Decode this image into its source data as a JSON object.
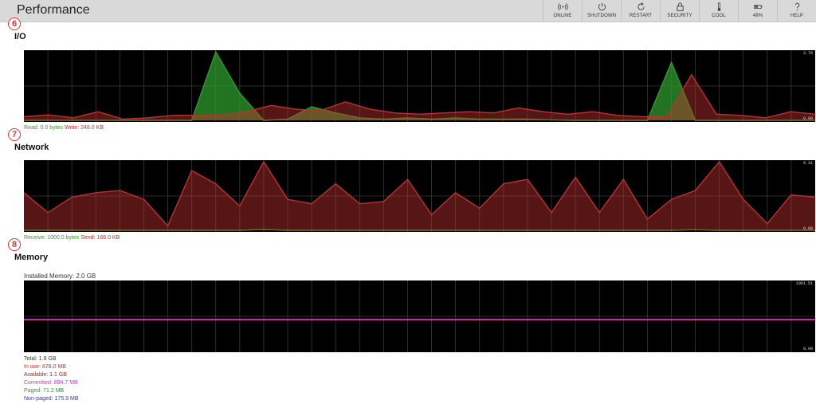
{
  "header": {
    "title": "Performance",
    "toolbar": [
      {
        "id": "online",
        "label": "ONLINE",
        "icon": "wifi-icon"
      },
      {
        "id": "shutdown",
        "label": "SHUTDOWN",
        "icon": "power-icon"
      },
      {
        "id": "restart",
        "label": "RESTART",
        "icon": "restart-icon"
      },
      {
        "id": "security",
        "label": "SECURITY",
        "icon": "lock-icon"
      },
      {
        "id": "cool",
        "label": "COOL",
        "icon": "thermometer-icon"
      },
      {
        "id": "battery",
        "label": "49%",
        "icon": "battery-icon"
      },
      {
        "id": "help",
        "label": "HELP",
        "icon": "help-icon"
      }
    ]
  },
  "io": {
    "badge": "6",
    "title": "I/O",
    "max_label": "2.78",
    "min_label": "0.00",
    "read_text": "Read: 0.0 bytes",
    "write_text": "Write: 248.0 KB",
    "read_color": "#2e9b2e",
    "write_color": "#c03030"
  },
  "network": {
    "badge": "7",
    "title": "Network",
    "max_label": "0.31",
    "min_label": "0.00",
    "receive_text": "Receive: 1000.0 bytes",
    "send_text": "Send: 166.0 KB",
    "receive_color": "#2e9b2e",
    "send_color": "#c03030"
  },
  "memory": {
    "badge": "8",
    "title": "Memory",
    "installed": "Installed Memory: 2.0 GB",
    "max_label": "1961.51",
    "min_label": "0.00",
    "stats": [
      {
        "text": "Total: 1.9 GB",
        "color": "#333333"
      },
      {
        "text": "In use: 878.0 MB",
        "color": "#c03030"
      },
      {
        "text": "Available: 1.1 GB",
        "color": "#8b2b2b"
      },
      {
        "text": "Committed: 894.7 MB",
        "color": "#c23bc2"
      },
      {
        "text": "Paged: 71.2 MB",
        "color": "#2e9b2e"
      },
      {
        "text": "Non-paged: 175.9 MB",
        "color": "#3a3aa8"
      }
    ]
  },
  "chart_data": [
    {
      "type": "area",
      "ylim": [
        0,
        2.78
      ],
      "grid": true,
      "series": [
        {
          "name": "Read",
          "color": "#2e9b2e",
          "values": [
            0,
            0,
            0,
            0,
            0,
            0,
            0,
            0,
            2.78,
            1.1,
            0,
            0.05,
            0.55,
            0.3,
            0.1,
            0.05,
            0.1,
            0.05,
            0.1,
            0.05,
            0.05,
            0.05,
            0.02,
            0,
            0,
            0,
            0,
            2.35,
            0,
            0,
            0,
            0,
            0,
            0
          ]
        },
        {
          "name": "Write",
          "color": "#c03030",
          "values": [
            0.15,
            0.22,
            0.1,
            0.35,
            0.05,
            0.1,
            0.2,
            0.2,
            0.2,
            0.35,
            0.6,
            0.45,
            0.4,
            0.75,
            0.45,
            0.3,
            0.25,
            0.3,
            0.35,
            0.3,
            0.5,
            0.35,
            0.25,
            0.35,
            0.2,
            0.15,
            0.15,
            1.85,
            0.25,
            0.2,
            0.1,
            0.35,
            0.25
          ]
        }
      ]
    },
    {
      "type": "area",
      "ylim": [
        0,
        0.31
      ],
      "grid": true,
      "series": [
        {
          "name": "Receive",
          "color": "#2e9b2e",
          "values": [
            0,
            0,
            0,
            0,
            0,
            0,
            0,
            0,
            0,
            0,
            0.004,
            0,
            0,
            0,
            0,
            0,
            0,
            0,
            0,
            0,
            0,
            0,
            0,
            0,
            0,
            0,
            0,
            0,
            0.003,
            0,
            0,
            0,
            0,
            0
          ]
        },
        {
          "name": "Send",
          "color": "#c03030",
          "values": [
            0.17,
            0.08,
            0.15,
            0.17,
            0.18,
            0.14,
            0.02,
            0.27,
            0.21,
            0.11,
            0.31,
            0.14,
            0.12,
            0.21,
            0.12,
            0.13,
            0.23,
            0.07,
            0.17,
            0.1,
            0.21,
            0.23,
            0.08,
            0.24,
            0.08,
            0.23,
            0.05,
            0.14,
            0.18,
            0.31,
            0.14,
            0.03,
            0.16,
            0.15
          ]
        }
      ]
    },
    {
      "type": "line",
      "ylim": [
        0,
        1961.51
      ],
      "grid": true,
      "series": [
        {
          "name": "In use",
          "color": "#c03030",
          "values": [
            878,
            878,
            878,
            878,
            878,
            878,
            878,
            878,
            878,
            878,
            878,
            878,
            878,
            878,
            878,
            878,
            878,
            878,
            878,
            878,
            878,
            878,
            878,
            878,
            878,
            878,
            878,
            878,
            878,
            878,
            878,
            878,
            878,
            878
          ]
        },
        {
          "name": "Committed",
          "color": "#c23bc2",
          "values": [
            894.7,
            894.7,
            894.7,
            894.7,
            894.7,
            894.7,
            894.7,
            894.7,
            894.7,
            894.7,
            894.7,
            894.7,
            894.7,
            894.7,
            894.7,
            894.7,
            894.7,
            894.7,
            894.7,
            894.7,
            894.7,
            894.7,
            894.7,
            894.7,
            894.7,
            894.7,
            894.7,
            894.7,
            894.7,
            894.7,
            894.7,
            894.7,
            894.7,
            894.7
          ]
        }
      ]
    }
  ]
}
